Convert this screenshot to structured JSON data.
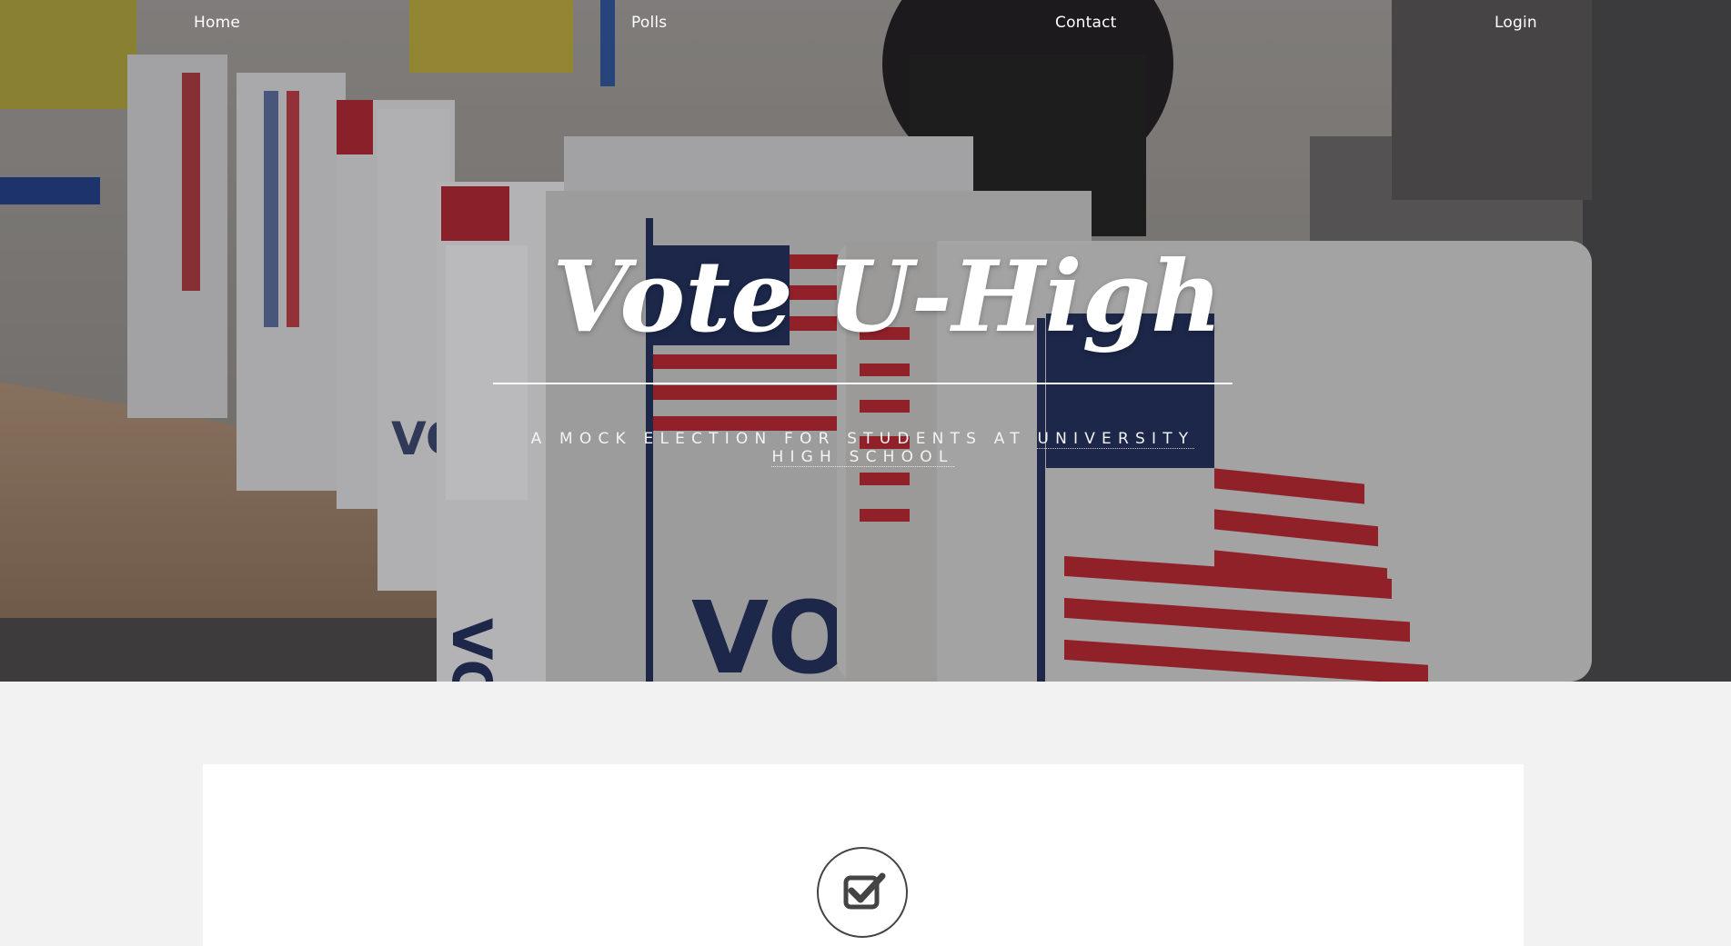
{
  "nav": {
    "items": [
      {
        "label": "Home"
      },
      {
        "label": "Polls"
      },
      {
        "label": "Contact"
      },
      {
        "label": "Login"
      }
    ]
  },
  "hero": {
    "title": "Vote U-High",
    "subtitle_prefix": "A mock election for students at ",
    "subtitle_link": "University High School"
  },
  "card": {
    "icon": "check-square-icon"
  },
  "colors": {
    "page_background": "#f2f2f2",
    "card_background": "#ffffff",
    "hero_text": "#ffffff",
    "flag_red": "#b8242e",
    "flag_blue": "#1f2f5a"
  }
}
